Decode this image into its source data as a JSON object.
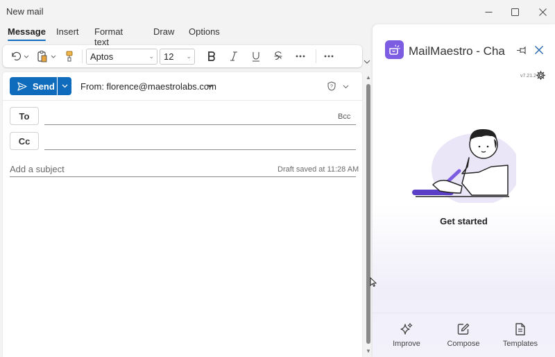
{
  "window": {
    "title": "New mail"
  },
  "ribbon": {
    "tabs": [
      {
        "label": "Message",
        "active": true
      },
      {
        "label": "Insert",
        "active": false
      },
      {
        "label": "Format text",
        "active": false
      },
      {
        "label": "Draw",
        "active": false
      },
      {
        "label": "Options",
        "active": false
      }
    ]
  },
  "toolbar": {
    "font_name": "Aptos",
    "font_size": "12",
    "icons": [
      "undo-icon",
      "paste-icon",
      "format-painter-icon",
      "bold-icon",
      "italic-icon",
      "underline-icon",
      "strikethrough-icon",
      "more-icon"
    ]
  },
  "compose": {
    "send_label": "Send",
    "from": "From: florence@maestrolabs.com",
    "to_label": "To",
    "cc_label": "Cc",
    "bcc_label": "Bcc",
    "subject_placeholder": "Add a subject",
    "draft_status": "Draft saved at 11:28 AM"
  },
  "panel": {
    "title": "MailMaestro - Cha",
    "version": "v7.21.2",
    "get_started": "Get started",
    "features": [
      {
        "label": "Improve",
        "icon": "sparkle-icon"
      },
      {
        "label": "Compose",
        "icon": "compose-icon"
      },
      {
        "label": "Templates",
        "icon": "templates-icon"
      }
    ]
  },
  "colors": {
    "accent": "#0f6cbd",
    "brand": "#7c5ce0"
  }
}
